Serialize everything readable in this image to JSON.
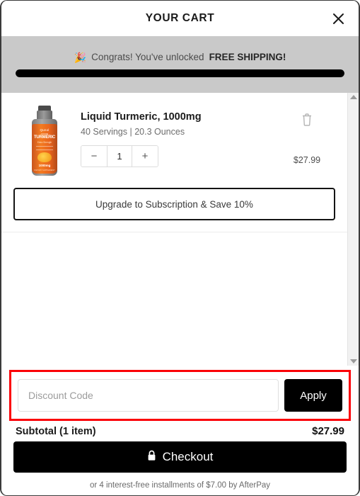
{
  "header": {
    "title": "YOUR CART",
    "close_icon": "close-icon"
  },
  "shipping_banner": {
    "emoji": "🎉",
    "message_prefix": "Congrats! You've unlocked ",
    "message_highlight": "FREE SHIPPING!",
    "progress_percent": 100,
    "bar_color": "#000000",
    "background_color": "#c9c9c9"
  },
  "items": [
    {
      "title": "Liquid Turmeric, 1000mg",
      "meta": "40 Servings | 20.3 Ounces",
      "quantity": "1",
      "price": "$27.99",
      "decrease_label": "−",
      "increase_label": "+",
      "remove_icon": "trash-icon",
      "thumbnail": {
        "brand": "Qunol",
        "sub": "LIQUID",
        "name": "TURMERIC",
        "flavor": "Extra Strength",
        "mg": "1000mg",
        "foot": "DIETARY SUPPLEMENT"
      }
    }
  ],
  "upgrade": {
    "label": "Upgrade to Subscription & Save 10%"
  },
  "scrollbar": {
    "up_icon": "chevron-up-icon",
    "down_icon": "chevron-down-icon"
  },
  "discount": {
    "placeholder": "Discount Code",
    "value": "",
    "apply_label": "Apply",
    "highlight_color": "#fb0007"
  },
  "summary": {
    "subtotal_label": "Subtotal (1 item)",
    "subtotal_value": "$27.99"
  },
  "checkout": {
    "label": "Checkout",
    "lock_icon": "lock-icon"
  },
  "afterpay": {
    "note": "or 4 interest-free installments of $7.00 by AfterPay"
  }
}
